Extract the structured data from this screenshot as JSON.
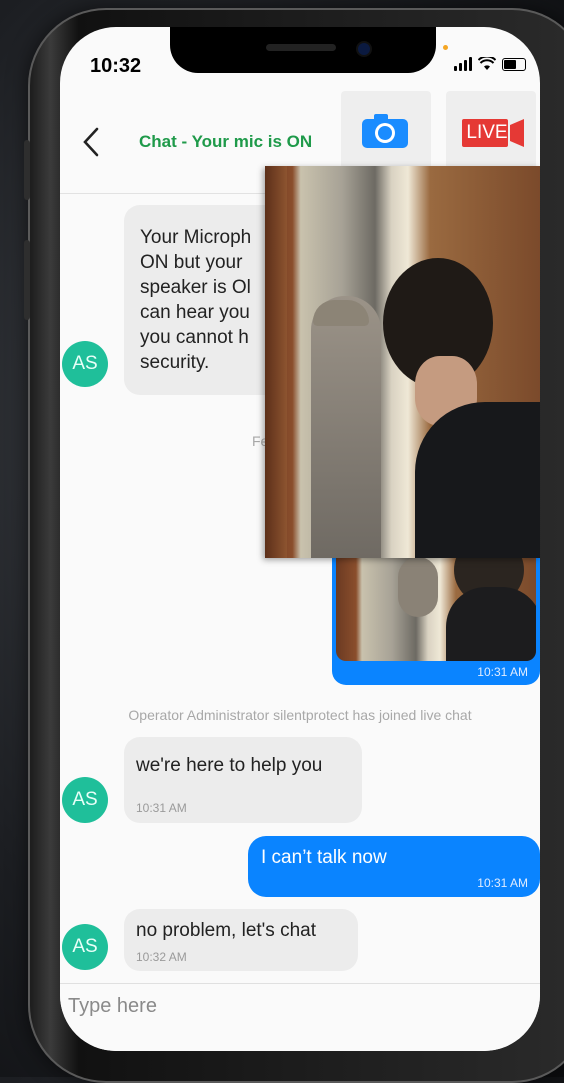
{
  "status_bar": {
    "time": "10:32"
  },
  "header": {
    "back_icon": "chevron-left-icon",
    "title": "Chat - Your mic is ON",
    "camera_icon": "camera-icon",
    "live_label": "LIVE"
  },
  "messages": {
    "first": {
      "sender": "AS",
      "text_lines": [
        "Your Microph",
        "ON but your",
        "speaker is Ol",
        "can hear you",
        "you cannot h",
        "security."
      ]
    },
    "partial_text": "Fe",
    "photo_time": "10:31 AM",
    "system_notice": "Operator Administrator silentprotect has joined live chat",
    "help": {
      "sender": "AS",
      "text": "we're here to help you",
      "time": "10:31 AM"
    },
    "cant_talk": {
      "text": "I can’t talk now",
      "time": "10:31 AM"
    },
    "no_problem": {
      "sender": "AS",
      "text": "no problem, let's chat",
      "time": "10:32 AM"
    }
  },
  "input": {
    "placeholder": "Type here"
  },
  "colors": {
    "accent": "#0a84ff",
    "title_green": "#1f9a4a",
    "avatar": "#1fbf9a",
    "live_red": "#e53935"
  }
}
